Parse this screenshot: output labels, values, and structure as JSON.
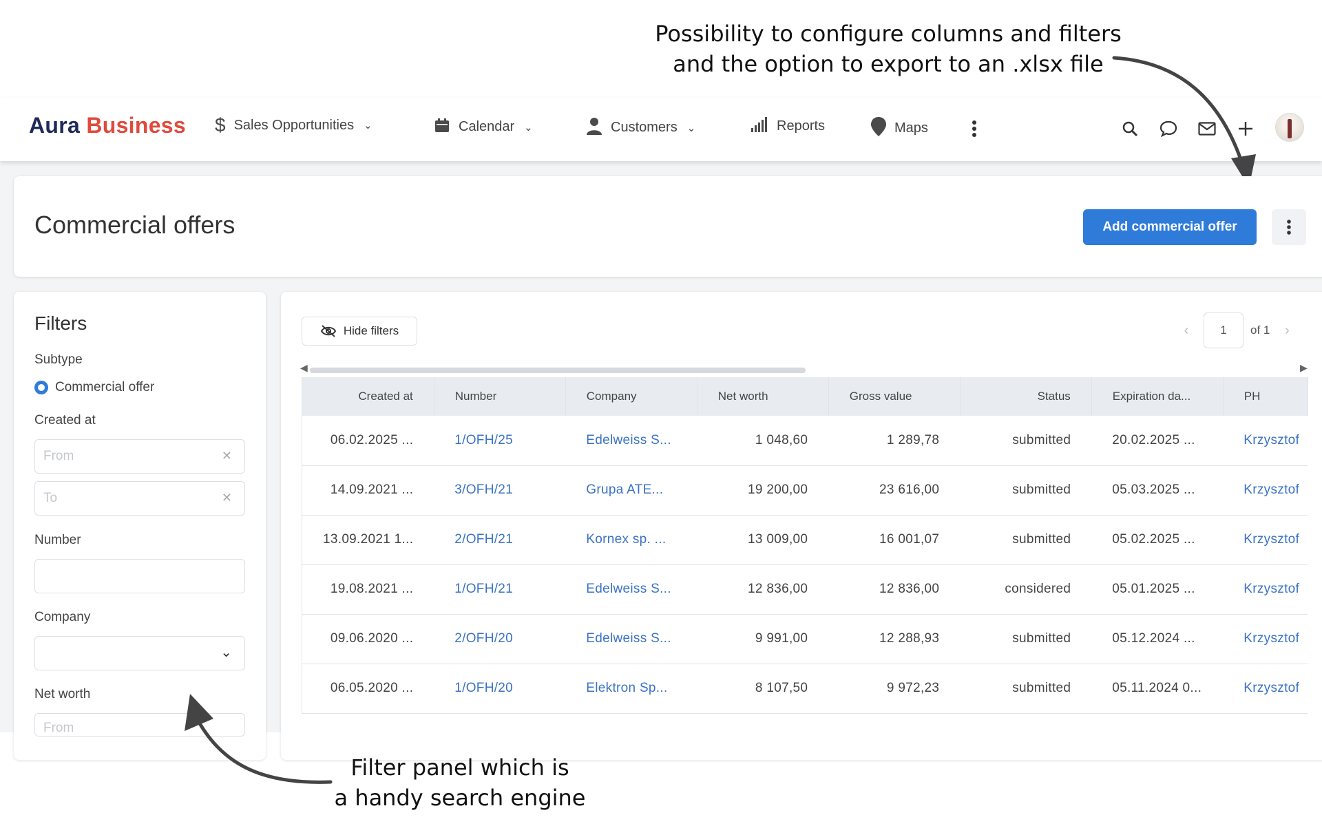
{
  "annotations": {
    "top_line1": "Possibility to configure columns and filters",
    "top_line2": "and the option to export to an .xlsx file",
    "bottom_line1": "Filter panel which is",
    "bottom_line2": "a handy search engine"
  },
  "brand": {
    "part1": "Aura",
    "part2": "Business"
  },
  "nav": {
    "items": [
      {
        "label": "Sales Opportunities",
        "icon": "dollar-icon"
      },
      {
        "label": "Calendar",
        "icon": "calendar-icon"
      },
      {
        "label": "Customers",
        "icon": "person-icon"
      },
      {
        "label": "Reports",
        "icon": "bar-chart-icon"
      },
      {
        "label": "Maps",
        "icon": "map-pin-icon"
      }
    ]
  },
  "header": {
    "title": "Commercial offers",
    "add_button": "Add commercial offer"
  },
  "filters": {
    "title": "Filters",
    "subtype_label": "Subtype",
    "subtype_option": "Commercial offer",
    "created_label": "Created at",
    "from_placeholder": "From",
    "to_placeholder": "To",
    "number_label": "Number",
    "company_label": "Company",
    "networth_label": "Net worth"
  },
  "table": {
    "hide_filters": "Hide filters",
    "page": "1",
    "page_of": "of 1",
    "columns": [
      "Created at",
      "Number",
      "Company",
      "Net worth",
      "Gross value",
      "Status",
      "Expiration da...",
      "PH"
    ],
    "rows": [
      [
        "06.02.2025 ...",
        "1/OFH/25",
        "Edelweiss S...",
        "1 048,60",
        "1 289,78",
        "submitted",
        "20.02.2025 ...",
        "Krzysztof"
      ],
      [
        "14.09.2021 ...",
        "3/OFH/21",
        "Grupa ATE...",
        "19 200,00",
        "23 616,00",
        "submitted",
        "05.03.2025 ...",
        "Krzysztof"
      ],
      [
        "13.09.2021 1...",
        "2/OFH/21",
        "Kornex sp. ...",
        "13 009,00",
        "16 001,07",
        "submitted",
        "05.02.2025 ...",
        "Krzysztof"
      ],
      [
        "19.08.2021 ...",
        "1/OFH/21",
        "Edelweiss S...",
        "12 836,00",
        "12 836,00",
        "considered",
        "05.01.2025 ...",
        "Krzysztof"
      ],
      [
        "09.06.2020 ...",
        "2/OFH/20",
        "Edelweiss S...",
        "9 991,00",
        "12 288,93",
        "submitted",
        "05.12.2024 ...",
        "Krzysztof"
      ],
      [
        "06.05.2020 ...",
        "1/OFH/20",
        "Elektron Sp...",
        "8 107,50",
        "9 972,23",
        "submitted",
        "05.11.2024 0...",
        "Krzysztof"
      ]
    ]
  },
  "colors": {
    "accent": "#2f7bd9",
    "brand_red": "#e04a3c",
    "brand_navy": "#1f2a5a",
    "link": "#3a72c4"
  }
}
